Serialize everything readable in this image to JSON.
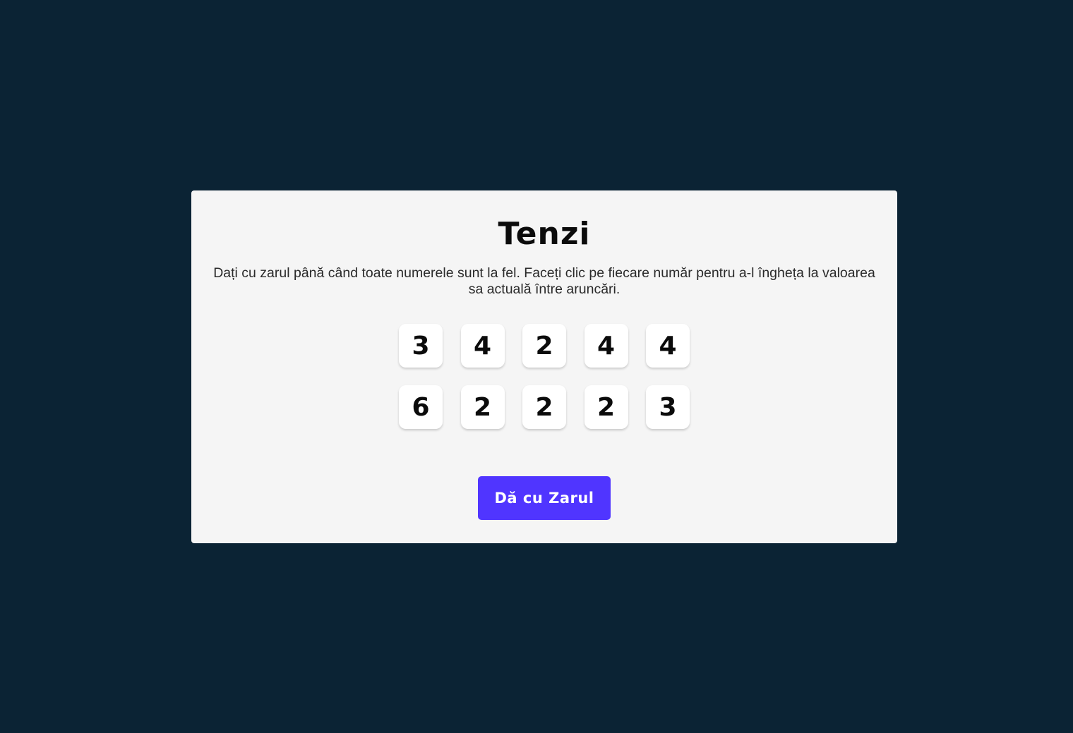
{
  "game": {
    "title": "Tenzi",
    "instructions": "Dați cu zarul până când toate numerele sunt la fel. Faceți clic pe fiecare număr pentru a-l îngheța la valoarea sa actuală între aruncări.",
    "dice": [
      {
        "value": "3"
      },
      {
        "value": "4"
      },
      {
        "value": "2"
      },
      {
        "value": "4"
      },
      {
        "value": "4"
      },
      {
        "value": "6"
      },
      {
        "value": "2"
      },
      {
        "value": "2"
      },
      {
        "value": "2"
      },
      {
        "value": "3"
      }
    ],
    "roll_button_label": "Dă cu Zarul"
  },
  "colors": {
    "background": "#0b2334",
    "card": "#f5f5f5",
    "die": "#ffffff",
    "accent": "#5035ff",
    "text": "#0b0b0b"
  }
}
